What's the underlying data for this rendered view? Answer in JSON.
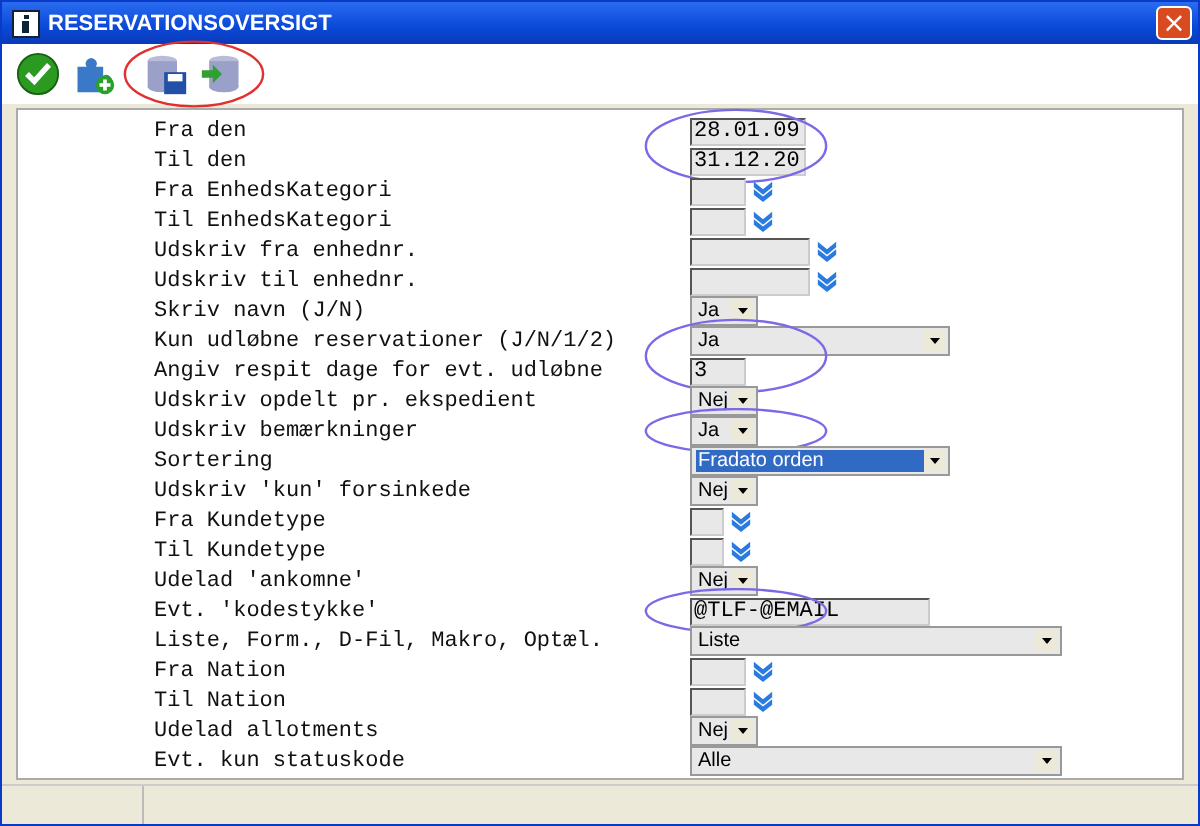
{
  "window": {
    "title": "RESERVATIONSOVERSIGT",
    "close": "×"
  },
  "toolbar": [
    {
      "kind": "ok",
      "circled": false
    },
    {
      "kind": "plugin",
      "circled": false
    },
    {
      "kind": "save",
      "circled": true
    },
    {
      "kind": "load",
      "circled": true
    }
  ],
  "rows": [
    {
      "label": "Fra den",
      "kind": "date",
      "value": "28.01.09",
      "circled": true
    },
    {
      "label": "Til den",
      "kind": "date",
      "value": "31.12.20",
      "circled": true
    },
    {
      "label": "Fra EnhedsKategori",
      "kind": "picker",
      "circled": false
    },
    {
      "label": "Til EnhedsKategori",
      "kind": "picker",
      "circled": false
    },
    {
      "label": "Udskriv fra enhednr.",
      "kind": "widepicker",
      "circled": false
    },
    {
      "label": "Udskriv til enhednr.",
      "kind": "widepicker",
      "circled": false
    },
    {
      "label": "Skriv navn (J/N)",
      "kind": "select",
      "value": "Ja",
      "highlighted": false,
      "circled": false
    },
    {
      "label": "Kun udløbne reservationer (J/N/1/2)",
      "kind": "wideselect",
      "value": "Ja",
      "highlighted": false,
      "circled": true
    },
    {
      "label": "Angiv respit dage for evt. udløbne",
      "kind": "number",
      "value": "3",
      "circled": true
    },
    {
      "label": "Udskriv opdelt pr. ekspedient",
      "kind": "select",
      "value": "Nej",
      "highlighted": false,
      "circled": false
    },
    {
      "label": "Udskriv bemærkninger",
      "kind": "select",
      "value": "Ja",
      "highlighted": false,
      "circled": true
    },
    {
      "label": "Sortering",
      "kind": "wideselect",
      "value": "Fradato orden",
      "highlighted": true,
      "circled": false
    },
    {
      "label": "Udskriv 'kun' forsinkede",
      "kind": "select",
      "value": "Nej",
      "highlighted": false,
      "circled": false
    },
    {
      "label": "Fra Kundetype",
      "kind": "tinypicker",
      "circled": false
    },
    {
      "label": "Til Kundetype",
      "kind": "tinypicker",
      "circled": false
    },
    {
      "label": "Udelad 'ankomne'",
      "kind": "select",
      "value": "Nej",
      "highlighted": false,
      "circled": false
    },
    {
      "label": "Evt. 'kodestykke'",
      "kind": "code",
      "value": "@TLF-@EMAIL",
      "circled": true
    },
    {
      "label": "Liste, Form., D-Fil, Makro, Optæl.",
      "kind": "longselect",
      "value": "Liste",
      "highlighted": false,
      "circled": false
    },
    {
      "label": "Fra Nation",
      "kind": "picker",
      "circled": false
    },
    {
      "label": "Til Nation",
      "kind": "picker",
      "circled": false
    },
    {
      "label": "Udelad allotments",
      "kind": "select",
      "value": "Nej",
      "highlighted": false,
      "circled": false
    },
    {
      "label": "Evt. kun statuskode",
      "kind": "longselect",
      "value": "Alle",
      "highlighted": false,
      "circled": false
    }
  ]
}
